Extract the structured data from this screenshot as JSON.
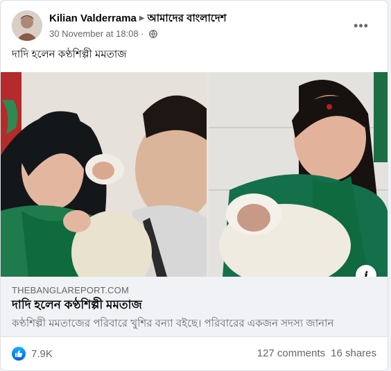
{
  "post": {
    "author": "Kilian Valderrama",
    "group": "আমাদের বাংলাদেশ",
    "timestamp": "30 November at 18:08",
    "privacy_icon": "globe-icon",
    "caption": "দাদি হলেন কণ্ঠশিল্পী মমতাজ"
  },
  "link_preview": {
    "domain": "THEBANGLAREPORT.COM",
    "title": "দাদি হলেন কণ্ঠশিল্পী মমতাজ",
    "description": "কণ্ঠশিল্পী মমতাজের পরিবারে খুশির বন্যা বইছে। পরিবারের একজন সদস্য জানান",
    "info_label": "i"
  },
  "engagement": {
    "reactions_count": "7.9K",
    "comments": "127 comments",
    "shares": "16 shares"
  },
  "colors": {
    "accent": "#1877f2",
    "secondary_text": "#65676b",
    "link_box_bg": "#f0f2f5"
  }
}
